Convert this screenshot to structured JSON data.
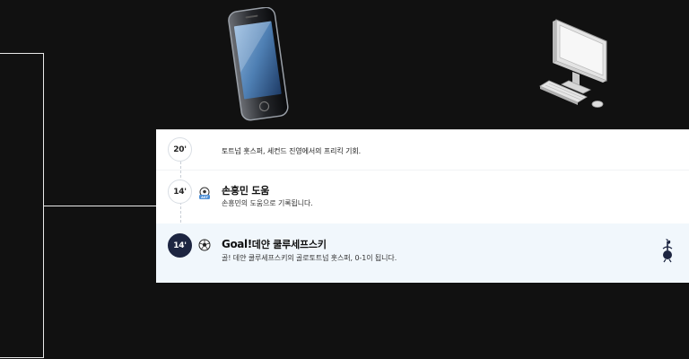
{
  "events": [
    {
      "minute": "20'",
      "text": "토트넘 홋스퍼, 세컨드 진영에서의 프리킥 기회."
    },
    {
      "minute": "14'",
      "title": "손흥민 도움",
      "text": "손흥민의 도움으로 기록됩니다.",
      "icon": "assist-icon"
    },
    {
      "minute": "14'",
      "title_prefix": "Goal!",
      "title": "데얀 쿨루세프스키",
      "text": "골! 데얀 쿨루세프스키의 골로토트넘 홋스퍼, 0-1이 됩니다.",
      "icon": "football-icon",
      "club": "tottenham-cockerel-icon"
    }
  ],
  "colors": {
    "background": "#111111",
    "goal_badge": "#1d2541",
    "highlight_row": "#f1f7fc"
  }
}
